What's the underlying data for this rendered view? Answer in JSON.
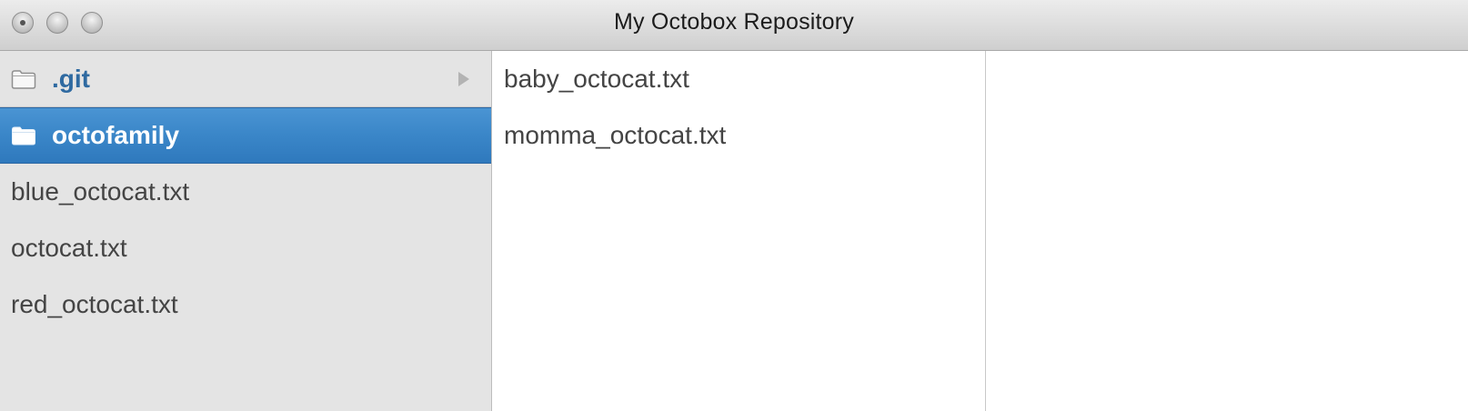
{
  "window": {
    "title": "My Octobox Repository",
    "buttons": [
      "close",
      "minimize",
      "zoom"
    ]
  },
  "columns": [
    {
      "items": [
        {
          "label": ".git",
          "kind": "folder",
          "icon": "folder-outline-icon",
          "has_children": true,
          "selected": false
        },
        {
          "label": "octofamily",
          "kind": "folder",
          "icon": "folder-filled-icon",
          "has_children": true,
          "selected": true
        },
        {
          "label": "blue_octocat.txt",
          "kind": "file"
        },
        {
          "label": "octocat.txt",
          "kind": "file"
        },
        {
          "label": "red_octocat.txt",
          "kind": "file"
        }
      ]
    },
    {
      "items": [
        {
          "label": "baby_octocat.txt",
          "kind": "file"
        },
        {
          "label": "momma_octocat.txt",
          "kind": "file"
        }
      ]
    },
    {
      "items": []
    }
  ],
  "colors": {
    "selection": "#3a86c8",
    "folder_text": "#2f6aa1",
    "sidebar_bg": "#e4e4e4"
  }
}
